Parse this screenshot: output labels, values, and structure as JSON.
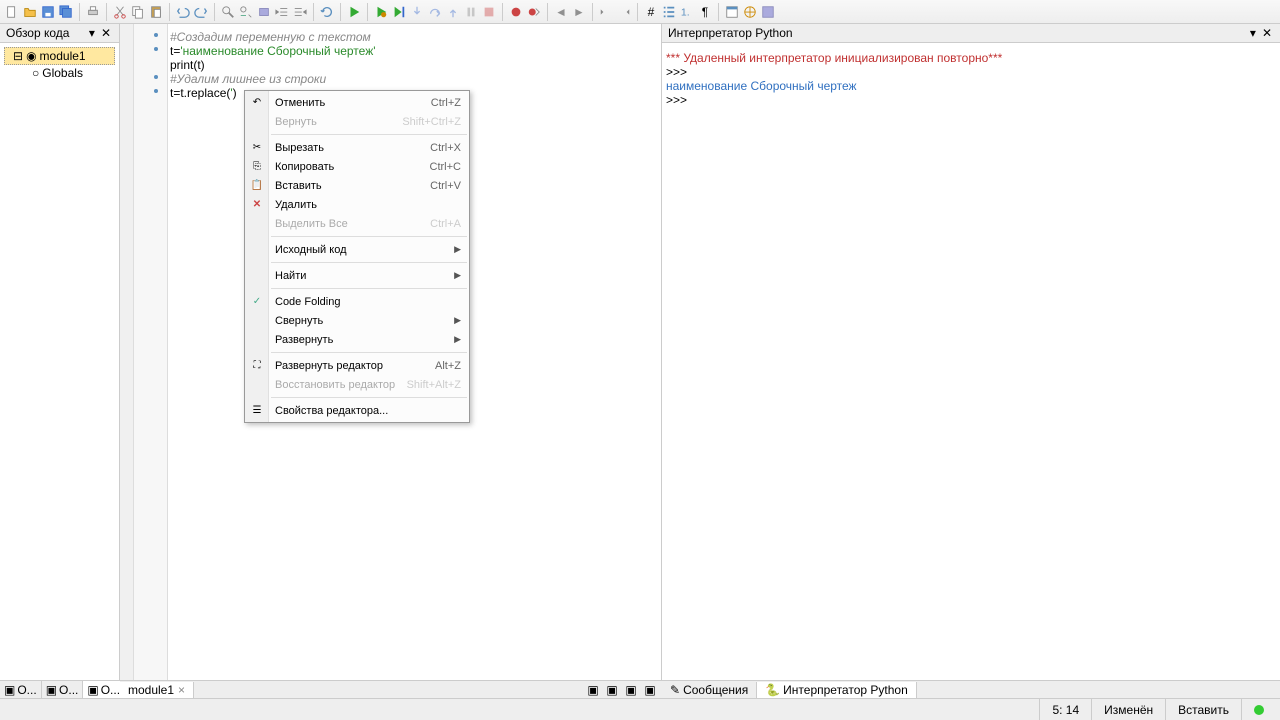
{
  "left_panel": {
    "title": "Обзор кода",
    "tree": {
      "root": "module1",
      "child": "Globals"
    }
  },
  "left_tabs": [
    "О...",
    "О...",
    "О..."
  ],
  "editor": {
    "tab": "module1",
    "lines": {
      "l1": "#Создадим переменную с текстом",
      "l2a": "t=",
      "l2b": "'наименование Сборочный чертеж'",
      "l3a": "print",
      "l3b": "(t)",
      "l4": "#Удалим лишнее из строки",
      "l5a": "t=t.replace(",
      "l5b": "'"
    }
  },
  "ctx": {
    "undo": "Отменить",
    "undo_k": "Ctrl+Z",
    "redo": "Вернуть",
    "redo_k": "Shift+Ctrl+Z",
    "cut": "Вырезать",
    "cut_k": "Ctrl+X",
    "copy": "Копировать",
    "copy_k": "Ctrl+C",
    "paste": "Вставить",
    "paste_k": "Ctrl+V",
    "delete": "Удалить",
    "selall": "Выделить Все",
    "selall_k": "Ctrl+A",
    "source": "Исходный код",
    "search": "Найти",
    "folding": "Code Folding",
    "collapse": "Свернуть",
    "expand": "Развернуть",
    "expand_ed": "Развернуть редактор",
    "expand_ed_k": "Alt+Z",
    "restore_ed": "Восстановить редактор",
    "restore_ed_k": "Shift+Alt+Z",
    "props": "Свойства редактора..."
  },
  "interpreter": {
    "title": "Интерпретатор Python",
    "line1": "*** Удаленный интерпретатор инициализирован повторно***",
    "prompt": ">>>",
    "output": "наименование Сборочный чертеж"
  },
  "bottom_tabs": {
    "messages": "Сообщения",
    "interpreter": "Интерпретатор Python"
  },
  "status": {
    "pos": "5: 14",
    "modified": "Изменён",
    "insert": "Вставить"
  }
}
